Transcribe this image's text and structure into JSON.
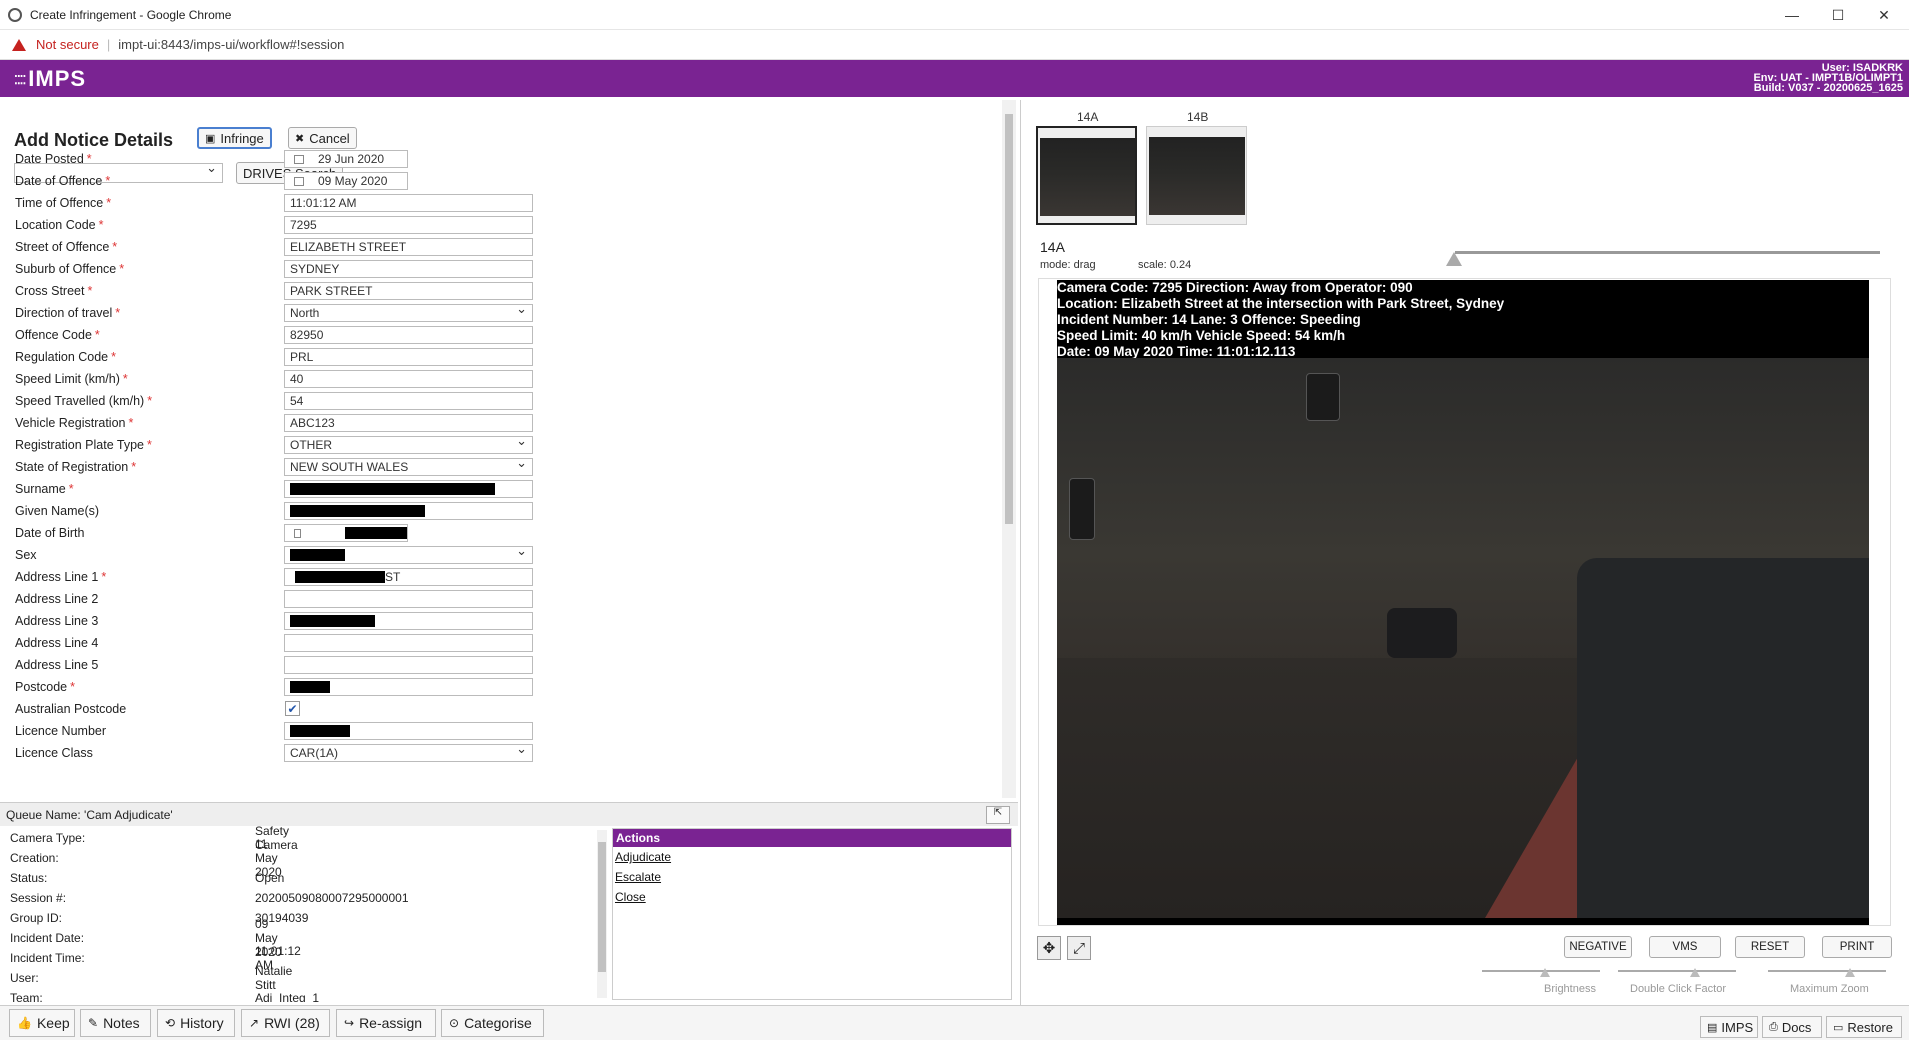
{
  "window": {
    "title": "Create Infringement - Google Chrome"
  },
  "address": {
    "security": "Not secure",
    "url": "impt-ui:8443/imps-ui/workflow#!session"
  },
  "header": {
    "logo": "IMPS",
    "user": "User: ISADKRK",
    "env": "Env: UAT - IMPT1B/OLIMPT1",
    "build": "Build: V037 - 20200625_1625"
  },
  "form": {
    "title": "Add Notice Details",
    "infringe_label": "Infringe",
    "cancel_label": "Cancel",
    "drives_label": "DRIVES Search",
    "fields": [
      {
        "label": "Date Posted",
        "required": true,
        "value": "29 Jun 2020"
      },
      {
        "label": "Date of Offence",
        "required": true,
        "value": "09 May 2020"
      },
      {
        "label": "Time of Offence",
        "required": true,
        "value": "11:01:12 AM"
      },
      {
        "label": "Location Code",
        "required": true,
        "value": "7295"
      },
      {
        "label": "Street of Offence",
        "required": true,
        "value": "ELIZABETH STREET"
      },
      {
        "label": "Suburb of Offence",
        "required": true,
        "value": "SYDNEY"
      },
      {
        "label": "Cross Street",
        "required": true,
        "value": "PARK STREET"
      },
      {
        "label": "Direction of travel",
        "required": true,
        "value": "North"
      },
      {
        "label": "Offence Code",
        "required": true,
        "value": "82950"
      },
      {
        "label": "Regulation Code",
        "required": true,
        "value": "PRL"
      },
      {
        "label": "Speed Limit (km/h)",
        "required": true,
        "value": "40"
      },
      {
        "label": "Speed Travelled (km/h)",
        "required": true,
        "value": "54"
      },
      {
        "label": "Vehicle Registration",
        "required": true,
        "value": "ABC123"
      },
      {
        "label": "Registration Plate Type",
        "required": true,
        "value": "OTHER"
      },
      {
        "label": "State of Registration",
        "required": true,
        "value": "NEW SOUTH WALES"
      },
      {
        "label": "Surname",
        "required": true,
        "value": ""
      },
      {
        "label": "Given Name(s)",
        "required": false,
        "value": ""
      },
      {
        "label": "Date of Birth",
        "required": false,
        "value": ""
      },
      {
        "label": "Sex",
        "required": false,
        "value": ""
      },
      {
        "label": "Address Line 1",
        "required": true,
        "value": "ST"
      },
      {
        "label": "Address Line 2",
        "required": false,
        "value": ""
      },
      {
        "label": "Address Line 3",
        "required": false,
        "value": ""
      },
      {
        "label": "Address Line 4",
        "required": false,
        "value": ""
      },
      {
        "label": "Address Line 5",
        "required": false,
        "value": ""
      },
      {
        "label": "Postcode",
        "required": true,
        "value": ""
      },
      {
        "label": "Australian Postcode",
        "required": false,
        "value": ""
      },
      {
        "label": "Licence Number",
        "required": false,
        "value": ""
      },
      {
        "label": "Licence Class",
        "required": false,
        "value": "CAR(1A)"
      }
    ],
    "required_mark": "*"
  },
  "queue": {
    "name": "Queue Name: 'Cam Adjudicate'",
    "rows": [
      {
        "label": "Camera Type:",
        "value": "Safety Camera"
      },
      {
        "label": "Creation:",
        "value": "11 May 2020"
      },
      {
        "label": "Status:",
        "value": "Open"
      },
      {
        "label": "Session #:",
        "value": "20200509080007295000001"
      },
      {
        "label": "Group ID:",
        "value": "30194039"
      },
      {
        "label": "Incident Date:",
        "value": "09 May 2020"
      },
      {
        "label": "Incident Time:",
        "value": "11:01:12 AM"
      },
      {
        "label": "User:",
        "value": "Natalie Stitt"
      },
      {
        "label": "Team:",
        "value": "Adj_Integ_1"
      }
    ],
    "actions_title": "Actions",
    "actions": [
      "Adjudicate",
      "Escalate",
      "Close"
    ]
  },
  "footer": {
    "buttons": [
      "Keep",
      "Notes",
      "History",
      "RWI (28)",
      "Re-assign",
      "Categorise"
    ],
    "right_buttons": [
      "IMPS",
      "Docs",
      "Restore"
    ]
  },
  "viewer": {
    "thumbs": [
      "14A",
      "14B"
    ],
    "current": "14A",
    "mode_label": "mode:",
    "mode_value": "drag",
    "scale_label": "scale:",
    "scale_value": "0.24",
    "overlay": [
      "Camera Code: 7295   Direction: Away from  Operator: 090",
      "Location: Elizabeth Street at the intersection with Park Street, Sydney",
      "Incident Number: 14   Lane: 3   Offence: Speeding",
      "Speed Limit: 40   km/h  Vehicle Speed: 54   km/h",
      "Date: 09 May 2020   Time: 11:01:12.113"
    ],
    "controls": [
      "NEGATIVE",
      "VMS",
      "RESET",
      "PRINT"
    ],
    "sliders": [
      "Brightness",
      "Double Click Factor",
      "Maximum Zoom"
    ]
  }
}
